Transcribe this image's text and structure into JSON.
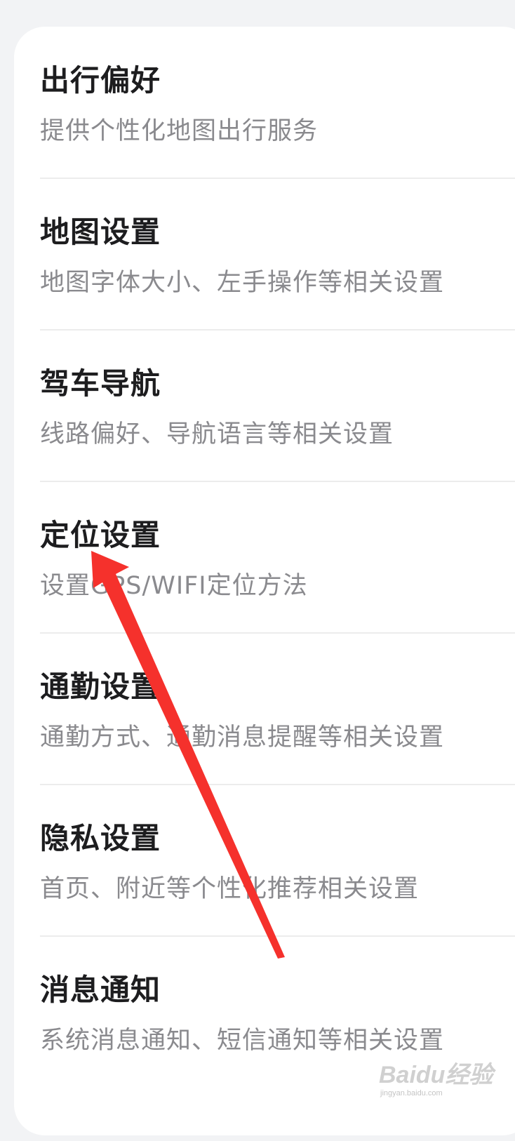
{
  "settings": {
    "items": [
      {
        "title": "出行偏好",
        "subtitle": "提供个性化地图出行服务"
      },
      {
        "title": "地图设置",
        "subtitle": "地图字体大小、左手操作等相关设置"
      },
      {
        "title": "驾车导航",
        "subtitle": "线路偏好、导航语言等相关设置"
      },
      {
        "title": "定位设置",
        "subtitle": "设置GPS/WIFI定位方法"
      },
      {
        "title": "通勤设置",
        "subtitle": "通勤方式、通勤消息提醒等相关设置"
      },
      {
        "title": "隐私设置",
        "subtitle": "首页、附近等个性化推荐相关设置"
      },
      {
        "title": "消息通知",
        "subtitle": "系统消息通知、短信通知等相关设置"
      }
    ]
  },
  "annotation": {
    "arrow_color": "#f5312c"
  },
  "watermark": {
    "logo": "Baidu经验",
    "url": "jingyan.baidu.com"
  }
}
